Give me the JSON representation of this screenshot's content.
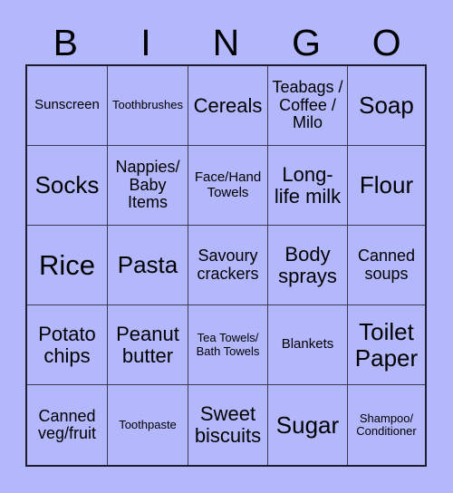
{
  "header": {
    "letters": [
      "B",
      "I",
      "N",
      "G",
      "O"
    ]
  },
  "grid": {
    "columns": 5,
    "rows": 5,
    "cells": [
      {
        "text": "Sunscreen",
        "size": "md"
      },
      {
        "text": "Toothbrushes",
        "size": "sm"
      },
      {
        "text": "Cereals",
        "size": "xl"
      },
      {
        "text": "Teabags / Coffee / Milo",
        "size": "lg"
      },
      {
        "text": "Soap",
        "size": "xxl"
      },
      {
        "text": "Socks",
        "size": "xxl"
      },
      {
        "text": "Nappies/ Baby Items",
        "size": "lg"
      },
      {
        "text": "Face/Hand Towels",
        "size": "md"
      },
      {
        "text": "Long-life milk",
        "size": "xl"
      },
      {
        "text": "Flour",
        "size": "xxl"
      },
      {
        "text": "Rice",
        "size": "huge"
      },
      {
        "text": "Pasta",
        "size": "xxl"
      },
      {
        "text": "Savoury crackers",
        "size": "lg"
      },
      {
        "text": "Body sprays",
        "size": "xl"
      },
      {
        "text": "Canned soups",
        "size": "lg"
      },
      {
        "text": "Potato chips",
        "size": "xl"
      },
      {
        "text": "Peanut butter",
        "size": "xl"
      },
      {
        "text": "Tea Towels/ Bath Towels",
        "size": "sm"
      },
      {
        "text": "Blankets",
        "size": "md"
      },
      {
        "text": "Toilet Paper",
        "size": "xxl"
      },
      {
        "text": "Canned veg/fruit",
        "size": "lg"
      },
      {
        "text": "Toothpaste",
        "size": "sm"
      },
      {
        "text": "Sweet biscuits",
        "size": "xl"
      },
      {
        "text": "Sugar",
        "size": "xxl"
      },
      {
        "text": "Shampoo/ Conditioner",
        "size": "sm"
      }
    ]
  },
  "colors": {
    "background": "#b3b7fc",
    "border": "#1c1c2e",
    "gridline": "#3a3a52",
    "text": "#000000"
  }
}
